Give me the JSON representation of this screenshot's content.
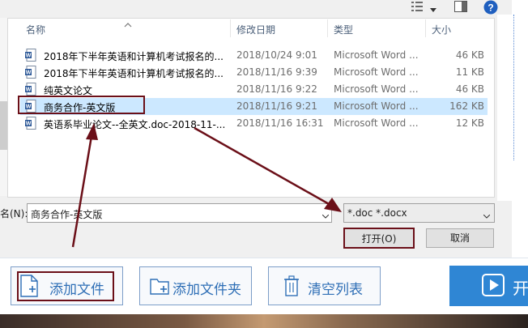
{
  "dialog": {
    "columns": {
      "name": "名称",
      "date": "修改日期",
      "type": "类型",
      "size": "大小"
    },
    "files": [
      {
        "name": "2018年下半年英语和计算机考试报名的...",
        "date": "2018/10/24 9:01",
        "type": "Microsoft Word ...",
        "size": "46 KB",
        "selected": false
      },
      {
        "name": "2018年下半年英语和计算机考试报名的...",
        "date": "2018/11/16 9:39",
        "type": "Microsoft Word ...",
        "size": "11 KB",
        "selected": false
      },
      {
        "name": "纯英文论文",
        "date": "2018/11/16 9:22",
        "type": "Microsoft Word ...",
        "size": "46 KB",
        "selected": false
      },
      {
        "name": "商务合作-英文版",
        "date": "2018/11/16 9:21",
        "type": "Microsoft Word ...",
        "size": "162 KB",
        "selected": true
      },
      {
        "name": "英语系毕业论文--全英文.doc-2018-11-...",
        "date": "2018/11/16 16:31",
        "type": "Microsoft Word ...",
        "size": "12 KB",
        "selected": false
      }
    ],
    "filename_label": "名(N):",
    "filename_value": "商务合作-英文版",
    "filetype_value": "*.doc *.docx",
    "open_label": "打开(O)",
    "cancel_label": "取消"
  },
  "app": {
    "add_file_label": "添加文件",
    "add_folder_label": "添加文件夹",
    "clear_list_label": "清空列表",
    "start_label": "开"
  },
  "colors": {
    "selection": "#cce8ff",
    "annotation": "#6b0f18",
    "accent": "#2f86d4"
  }
}
